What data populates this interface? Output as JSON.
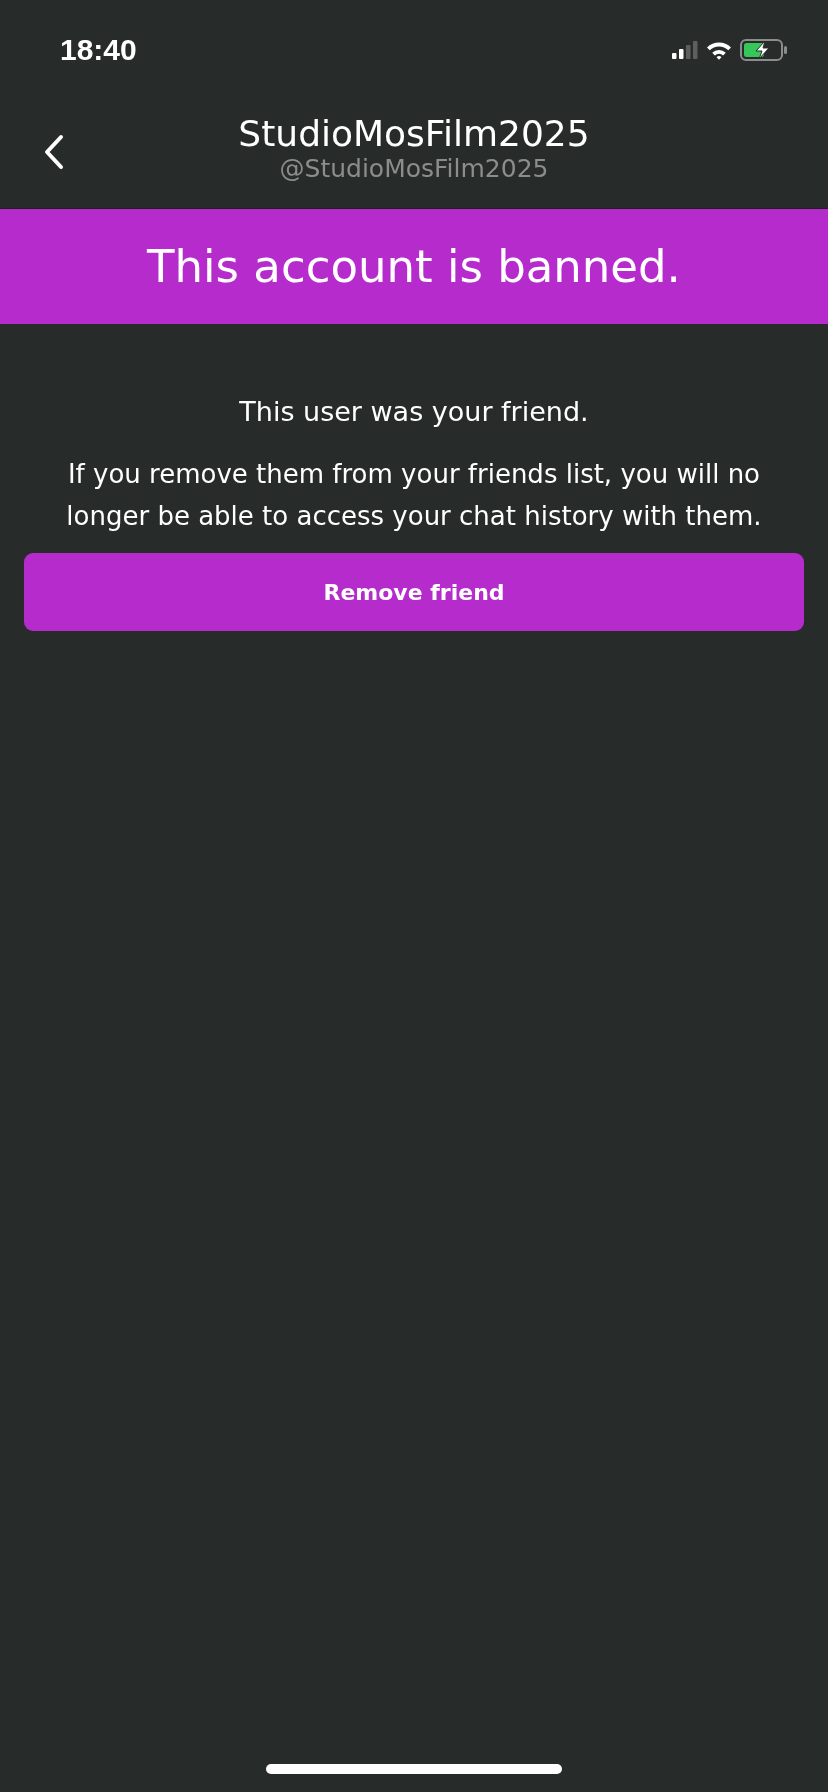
{
  "status_bar": {
    "time": "18:40"
  },
  "header": {
    "title": "StudioMosFilm2025",
    "handle": "@StudioMosFilm2025"
  },
  "banner": {
    "text": "This account is banned."
  },
  "notice": {
    "heading": "This user was your friend.",
    "body": "If you remove them from your friends list, you will no longer be able to access your chat history with them."
  },
  "button": {
    "label": "Remove friend"
  }
}
